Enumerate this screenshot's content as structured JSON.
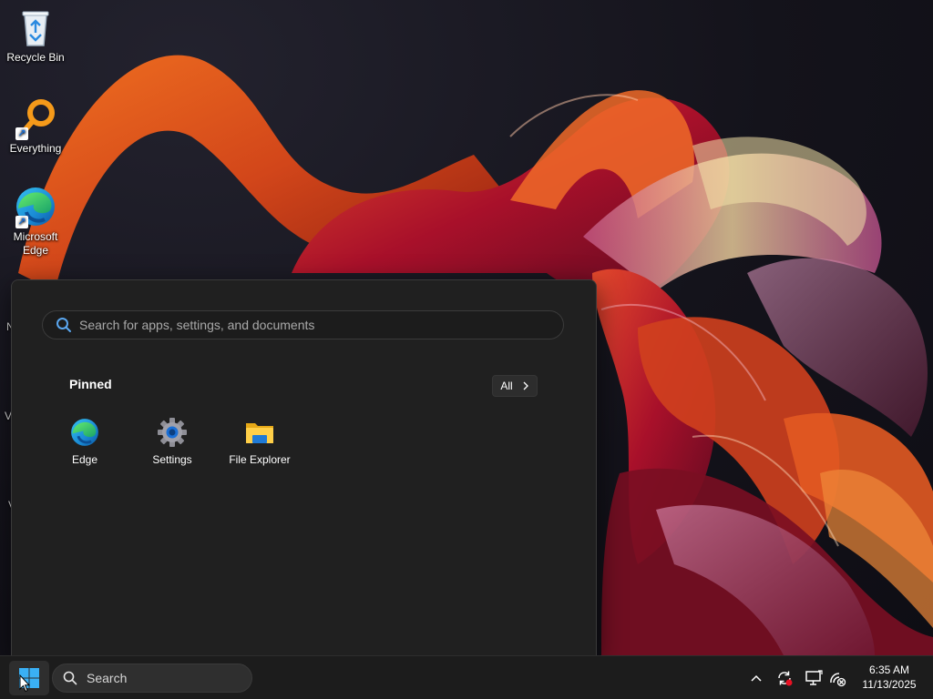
{
  "desktop": {
    "icons": [
      {
        "label": "Recycle Bin",
        "icon": "recycle-bin-icon"
      },
      {
        "label": "Everything",
        "icon": "everything-search-icon"
      },
      {
        "label": "Microsoft Edge",
        "icon": "edge-icon"
      }
    ],
    "partial_letters": [
      "N",
      "V",
      "V"
    ]
  },
  "start_menu": {
    "search": {
      "placeholder": "Search for apps, settings, and documents",
      "value": ""
    },
    "pinned_heading": "Pinned",
    "all_button": {
      "label": "All",
      "icon": "chevron-right-icon"
    },
    "pinned_apps": [
      {
        "label": "Edge",
        "icon": "edge-icon"
      },
      {
        "label": "Settings",
        "icon": "gear-icon"
      },
      {
        "label": "File Explorer",
        "icon": "folder-icon"
      }
    ]
  },
  "taskbar": {
    "start_icon": "windows-logo-icon",
    "search_label": "Search",
    "tray": {
      "icons": [
        "chevron-up-icon",
        "sync-icon",
        "display-icon",
        "network-disconnected-icon"
      ]
    },
    "clock": {
      "time": "6:35 AM",
      "date": "11/13/2025"
    }
  },
  "colors": {
    "accent": "#0078d4",
    "menu_background": "#202020",
    "taskbar_background": "#1c1c1c",
    "wallpaper_orange": "#e8561a",
    "wallpaper_red": "#b5122e"
  }
}
